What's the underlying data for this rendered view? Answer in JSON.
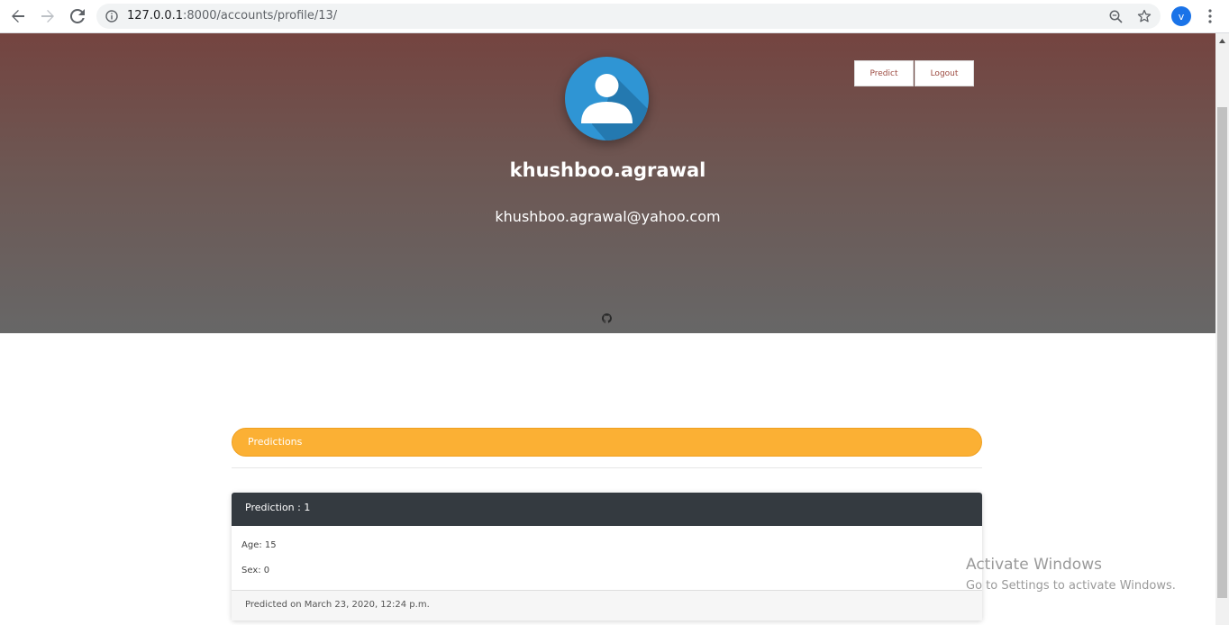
{
  "browser": {
    "url_host": "127.0.0.1",
    "url_rest": ":8000/accounts/profile/13/",
    "profile_initial": "v"
  },
  "header": {
    "username": "khushboo.agrawal",
    "email": "khushboo.agrawal@yahoo.com",
    "predict_label": "Predict",
    "logout_label": "Logout"
  },
  "section": {
    "title": "Predictions"
  },
  "predictions": [
    {
      "title": "Prediction : 1",
      "age": "Age: 15",
      "sex": "Sex: 0",
      "footer": "Predicted on March 23, 2020, 12:24 p.m."
    }
  ],
  "watermark": {
    "line1": "Activate Windows",
    "line2": "Go to Settings to activate Windows."
  },
  "colors": {
    "hero_top": "#744440",
    "hero_bottom": "#676767",
    "accent": "#fbb034",
    "card_header": "#343a40",
    "avatar": "#2f95d4"
  }
}
